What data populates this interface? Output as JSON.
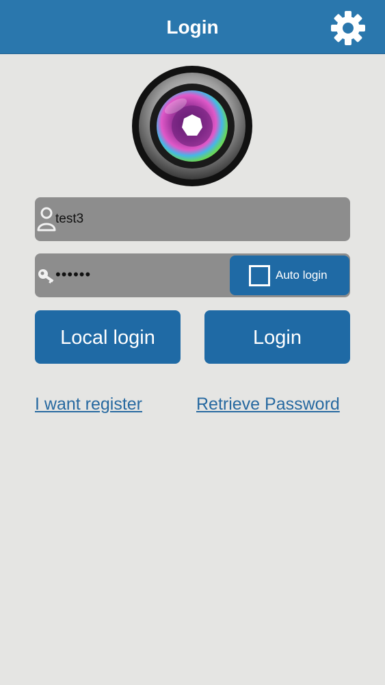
{
  "header": {
    "title": "Login",
    "settings_icon": "gear-icon"
  },
  "logo": {
    "icon": "camera-lens-icon"
  },
  "username": {
    "icon": "user-icon",
    "value": "test3"
  },
  "password": {
    "icon": "key-icon",
    "masked_value": "••••••",
    "auto_login": {
      "label": "Auto login",
      "checked": false
    }
  },
  "buttons": {
    "local_login": "Local login",
    "login": "Login"
  },
  "links": {
    "register": "I want register ",
    "retrieve_password": "Retrieve Password"
  },
  "colors": {
    "header": "#2a77ad",
    "button": "#1f6aa5",
    "link": "#2769a0",
    "field": "#8d8d8d",
    "background": "#e5e5e3"
  }
}
